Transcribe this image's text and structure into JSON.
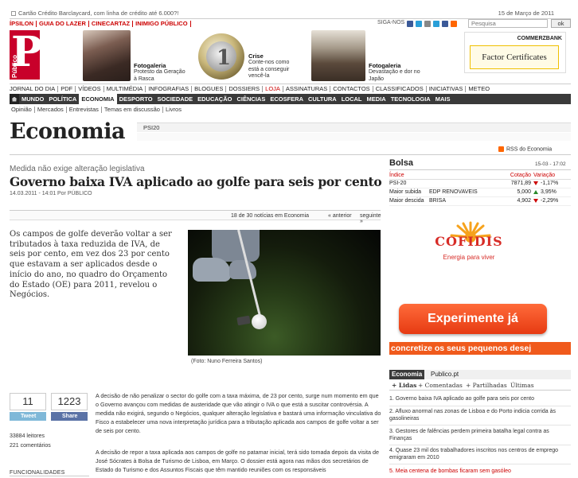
{
  "top": {
    "promo": "Cartão Crédito Barclaycard, com linha de crédito até 6.000?!",
    "date": "15 de Março de 2011",
    "nav": [
      "ÍPSILON",
      "GUIA DO LAZER",
      "CINECARTAZ",
      "INIMIGO PÚBLICO"
    ],
    "siga": "SIGA-NOS",
    "search_placeholder": "Pesquisa",
    "search_button": "ok"
  },
  "colors": {
    "brand": "#c8002a",
    "nav_dark": "#3a3a3a",
    "accent_orange": "#f05a1c"
  },
  "logo": {
    "letter": "P",
    "word": "Público"
  },
  "features": [
    {
      "title": "Fotogaleria",
      "desc": [
        "Protesto da Geração",
        "à Rasca"
      ]
    },
    {
      "title": "Crise",
      "desc": [
        "Conte-nos como",
        "está a conseguir",
        "vencê-la"
      ]
    },
    {
      "title": "Fotogaleria",
      "desc": [
        "Devastação e dor no",
        "Japão"
      ]
    }
  ],
  "ad_top": {
    "brand": "COMMERZBANK",
    "product": "Factor Certificates"
  },
  "menu": [
    {
      "label": "JORNAL DO DIA",
      "red": false
    },
    {
      "label": "PDF",
      "red": false
    },
    {
      "label": "VÍDEOS",
      "red": false
    },
    {
      "label": "MULTIMÉDIA",
      "red": false
    },
    {
      "label": "INFOGRAFIAS",
      "red": false
    },
    {
      "label": "BLOGUES",
      "red": false
    },
    {
      "label": "DOSSIERS",
      "red": false
    },
    {
      "label": "LOJA",
      "red": true
    },
    {
      "label": "ASSINATURAS",
      "red": false
    },
    {
      "label": "CONTACTOS",
      "red": false
    },
    {
      "label": "CLASSIFICADOS",
      "red": false
    },
    {
      "label": "INICIATIVAS",
      "red": false
    },
    {
      "label": "METEO",
      "red": false
    }
  ],
  "sections": [
    "MUNDO",
    "POLÍTICA",
    "ECONOMIA",
    "DESPORTO",
    "SOCIEDADE",
    "EDUCAÇÃO",
    "CIÊNCIAS",
    "ECOSFERA",
    "CULTURA",
    "LOCAL",
    "MEDIA",
    "TECNOLOGIA",
    "MAIS"
  ],
  "active_section": "ECONOMIA",
  "subnav": [
    "Opinião",
    "Mercados",
    "Entrevistas",
    "Temas em discussão",
    "Livros"
  ],
  "page_title": "Economia",
  "psi_label": "PSI20",
  "rss": "RSS do Economia",
  "article": {
    "kicker": "Medida não exige alteração legislativa",
    "headline": "Governo baixa IVA aplicado ao golfe para seis por cento",
    "date": "14.03.2011 - 14:01",
    "by": "Por PÚBLICO",
    "nav_count": "18 de 30 notícias em Economia",
    "prev": "« anterior",
    "next": "seguinte »",
    "lead": "Os campos de golfe deverão voltar a ser tributados à taxa reduzida de IVA, de seis por cento, em vez dos 23 por cento que estavam a ser aplicados desde o início do ano, no quadro do Orçamento do Estado (OE) para 2011, revelou o Negócios.",
    "caption": "(Foto: Nuno Ferreira Santos)",
    "body": [
      "A decisão de não penalizar o sector do golfe com a taxa máxima, de 23 por cento, surge num momento em que o Governo avançou com medidas de austeridade que vão atingir o IVA o que está a suscitar controvérsia. A medida não exigirá, segundo o Negócios, qualquer alteração legislativa e bastará uma informação vinculativa do Fisco a estabelecer uma nova interpretação jurídica para a tributação aplicada aos campos de golfe voltar a ser de seis por cento.",
      "A decisão de repor a taxa aplicada aos campos de golfe no patamar inicial, terá sido tomada depois da visita de José Sócrates à Bolsa de Turismo de Lisboa, em Março. O dossier está agora nas mãos dos secretários de Estado do Turismo e dos Assuntos Fiscais que têm mantido reuniões com os responsáveis"
    ]
  },
  "share": {
    "tweet_count": "11",
    "fb_count": "1223",
    "tweet_label": "Tweet",
    "fb_label": "Share",
    "reads": "33884 leitores",
    "comments": "221 comentários",
    "func": "FUNCIONALIDADES"
  },
  "bolsa": {
    "title": "Bolsa",
    "time": "15-03 - 17:02",
    "headers": [
      "Índice",
      "Cotação",
      "Variação"
    ],
    "index": {
      "name": "PSI-20",
      "value": "7871,89",
      "change": "-1,17%",
      "dir": "down"
    },
    "rows": [
      {
        "label": "Maior subida",
        "name": "EDP RENOVAVEIS",
        "value": "5,000",
        "change": "3,95%",
        "dir": "up"
      },
      {
        "label": "Maior descida",
        "name": "BRISA",
        "value": "4,902",
        "change": "-2,29%",
        "dir": "down"
      }
    ]
  },
  "ad_side": {
    "brand": "COFIDIS",
    "tagline": "Energia para viver",
    "cta": "Experimente já",
    "strip": "concretize os seus pequenos desej"
  },
  "rank": {
    "tabs": [
      "Economia",
      "Publico.pt"
    ],
    "sub": [
      "+ Lidas",
      "+ Comentadas",
      "+ Partilhadas",
      "Últimas"
    ],
    "items": [
      "1. Governo baixa IVA aplicado ao golfe para seis por cento",
      "2. Afluxo anormal nas zonas de Lisboa e do Porto indicia corrida às gasolineiras",
      "3. Gestores de falências perdem primeira batalha legal contra as Finanças",
      "4. Quase 23 mil dos trabalhadores inscritos nos centros de emprego emigraram em 2010",
      "5. Meia centena de bombas ficaram sem gasóleo"
    ]
  }
}
